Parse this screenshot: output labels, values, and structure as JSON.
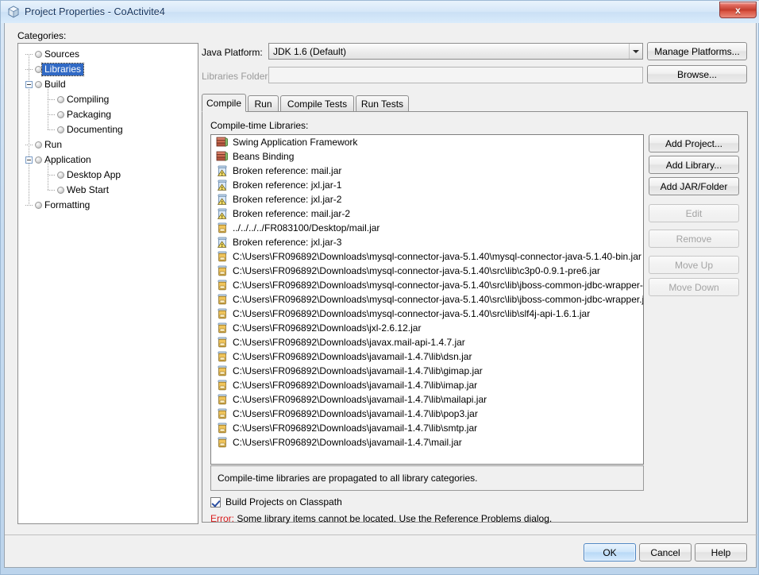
{
  "window": {
    "title": "Project Properties - CoActivite4",
    "title_icon": "cube-icon",
    "close_label": "x"
  },
  "categories": {
    "label": "Categories:",
    "items": [
      {
        "label": "Sources",
        "level": 0,
        "selected": false,
        "expander": null
      },
      {
        "label": "Libraries",
        "level": 0,
        "selected": true,
        "expander": null
      },
      {
        "label": "Build",
        "level": 0,
        "selected": false,
        "expander": "minus"
      },
      {
        "label": "Compiling",
        "level": 1,
        "selected": false,
        "expander": null
      },
      {
        "label": "Packaging",
        "level": 1,
        "selected": false,
        "expander": null
      },
      {
        "label": "Documenting",
        "level": 1,
        "selected": false,
        "expander": null
      },
      {
        "label": "Run",
        "level": 0,
        "selected": false,
        "expander": null
      },
      {
        "label": "Application",
        "level": 0,
        "selected": false,
        "expander": "minus"
      },
      {
        "label": "Desktop App",
        "level": 1,
        "selected": false,
        "expander": null
      },
      {
        "label": "Web Start",
        "level": 1,
        "selected": false,
        "expander": null
      },
      {
        "label": "Formatting",
        "level": 0,
        "selected": false,
        "expander": null
      }
    ]
  },
  "platform": {
    "label": "Java Platform:",
    "value": "JDK 1.6 (Default)",
    "manage_label": "Manage Platforms..."
  },
  "libraries_folder": {
    "label": "Libraries Folder:",
    "value": "",
    "browse_label": "Browse..."
  },
  "tabs": [
    {
      "label": "Compile",
      "active": true
    },
    {
      "label": "Run",
      "active": false
    },
    {
      "label": "Compile Tests",
      "active": false
    },
    {
      "label": "Run Tests",
      "active": false
    }
  ],
  "list": {
    "label": "Compile-time Libraries:",
    "items": [
      {
        "icon": "library-books-icon",
        "text": "Swing Application Framework"
      },
      {
        "icon": "library-books-icon",
        "text": "Beans Binding"
      },
      {
        "icon": "broken-jar-icon",
        "text": "Broken reference: mail.jar"
      },
      {
        "icon": "broken-jar-icon",
        "text": "Broken reference: jxl.jar-1"
      },
      {
        "icon": "broken-jar-icon",
        "text": "Broken reference: jxl.jar-2"
      },
      {
        "icon": "broken-jar-icon",
        "text": "Broken reference: mail.jar-2"
      },
      {
        "icon": "jar-icon",
        "text": "../../../../FR083100/Desktop/mail.jar"
      },
      {
        "icon": "broken-jar-icon",
        "text": "Broken reference: jxl.jar-3"
      },
      {
        "icon": "jar-icon",
        "text": "C:\\Users\\FR096892\\Downloads\\mysql-connector-java-5.1.40\\mysql-connector-java-5.1.40-bin.jar"
      },
      {
        "icon": "jar-icon",
        "text": "C:\\Users\\FR096892\\Downloads\\mysql-connector-java-5.1.40\\src\\lib\\c3p0-0.9.1-pre6.jar"
      },
      {
        "icon": "jar-icon",
        "text": "C:\\Users\\FR096892\\Downloads\\mysql-connector-java-5.1.40\\src\\lib\\jboss-common-jdbc-wrapper-src.jar"
      },
      {
        "icon": "jar-icon",
        "text": "C:\\Users\\FR096892\\Downloads\\mysql-connector-java-5.1.40\\src\\lib\\jboss-common-jdbc-wrapper.jar"
      },
      {
        "icon": "jar-icon",
        "text": "C:\\Users\\FR096892\\Downloads\\mysql-connector-java-5.1.40\\src\\lib\\slf4j-api-1.6.1.jar"
      },
      {
        "icon": "jar-icon",
        "text": "C:\\Users\\FR096892\\Downloads\\jxl-2.6.12.jar"
      },
      {
        "icon": "jar-icon",
        "text": "C:\\Users\\FR096892\\Downloads\\javax.mail-api-1.4.7.jar"
      },
      {
        "icon": "jar-icon",
        "text": "C:\\Users\\FR096892\\Downloads\\javamail-1.4.7\\lib\\dsn.jar"
      },
      {
        "icon": "jar-icon",
        "text": "C:\\Users\\FR096892\\Downloads\\javamail-1.4.7\\lib\\gimap.jar"
      },
      {
        "icon": "jar-icon",
        "text": "C:\\Users\\FR096892\\Downloads\\javamail-1.4.7\\lib\\imap.jar"
      },
      {
        "icon": "jar-icon",
        "text": "C:\\Users\\FR096892\\Downloads\\javamail-1.4.7\\lib\\mailapi.jar"
      },
      {
        "icon": "jar-icon",
        "text": "C:\\Users\\FR096892\\Downloads\\javamail-1.4.7\\lib\\pop3.jar"
      },
      {
        "icon": "jar-icon",
        "text": "C:\\Users\\FR096892\\Downloads\\javamail-1.4.7\\lib\\smtp.jar"
      },
      {
        "icon": "jar-icon",
        "text": "C:\\Users\\FR096892\\Downloads\\javamail-1.4.7\\mail.jar"
      }
    ]
  },
  "side_buttons": [
    {
      "label": "Add Project...",
      "enabled": true
    },
    {
      "label": "Add Library...",
      "enabled": true
    },
    {
      "label": "Add JAR/Folder",
      "enabled": true
    },
    {
      "label": "Edit",
      "enabled": false
    },
    {
      "label": "Remove",
      "enabled": false
    },
    {
      "label": "Move Up",
      "enabled": false
    },
    {
      "label": "Move Down",
      "enabled": false
    }
  ],
  "info_text": "Compile-time libraries are propagated to all library categories.",
  "checkbox": {
    "label": "Build Projects on Classpath",
    "checked": true
  },
  "error": {
    "prefix": "Error:",
    "message": "Some library items cannot be located. Use the Reference Problems dialog.",
    "color": "#d81b1b"
  },
  "footer_buttons": [
    {
      "label": "OK",
      "default": true
    },
    {
      "label": "Cancel",
      "default": false
    },
    {
      "label": "Help",
      "default": false
    }
  ]
}
